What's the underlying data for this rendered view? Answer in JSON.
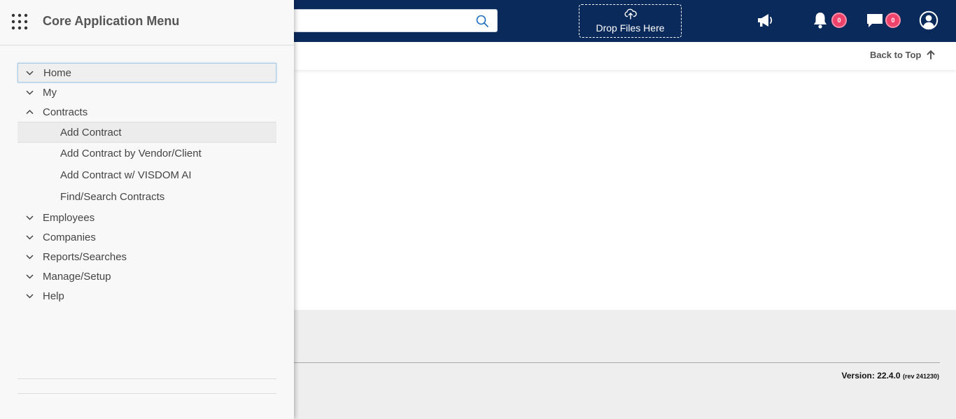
{
  "header": {
    "search": {
      "value": "",
      "placeholder": ""
    },
    "dropzone_label": "Drop Files Here",
    "notifications_count": "0",
    "messages_count": "0"
  },
  "content": {
    "back_to_top": "Back to Top"
  },
  "footer": {
    "version_label": "Version:",
    "version_number": "22.4.0",
    "revision": "(rev 241230)"
  },
  "menu": {
    "title": "Core Application Menu",
    "items": [
      {
        "label": "Home",
        "expanded": false
      },
      {
        "label": "My",
        "expanded": false
      },
      {
        "label": "Contracts",
        "expanded": true
      }
    ],
    "contracts_children": [
      {
        "label": "Add Contract"
      },
      {
        "label": "Add Contract by Vendor/Client"
      },
      {
        "label": "Add Contract w/ VISDOM AI"
      },
      {
        "label": "Find/Search Contracts"
      }
    ],
    "items_after": [
      {
        "label": "Employees"
      },
      {
        "label": "Companies"
      },
      {
        "label": "Reports/Searches"
      },
      {
        "label": "Manage/Setup"
      },
      {
        "label": "Help"
      }
    ]
  },
  "colors": {
    "header_bg": "#0b2a5c",
    "badge": "#f0436b",
    "menu_bg": "#f8f8f8",
    "footer_bg": "#eeeeee"
  }
}
